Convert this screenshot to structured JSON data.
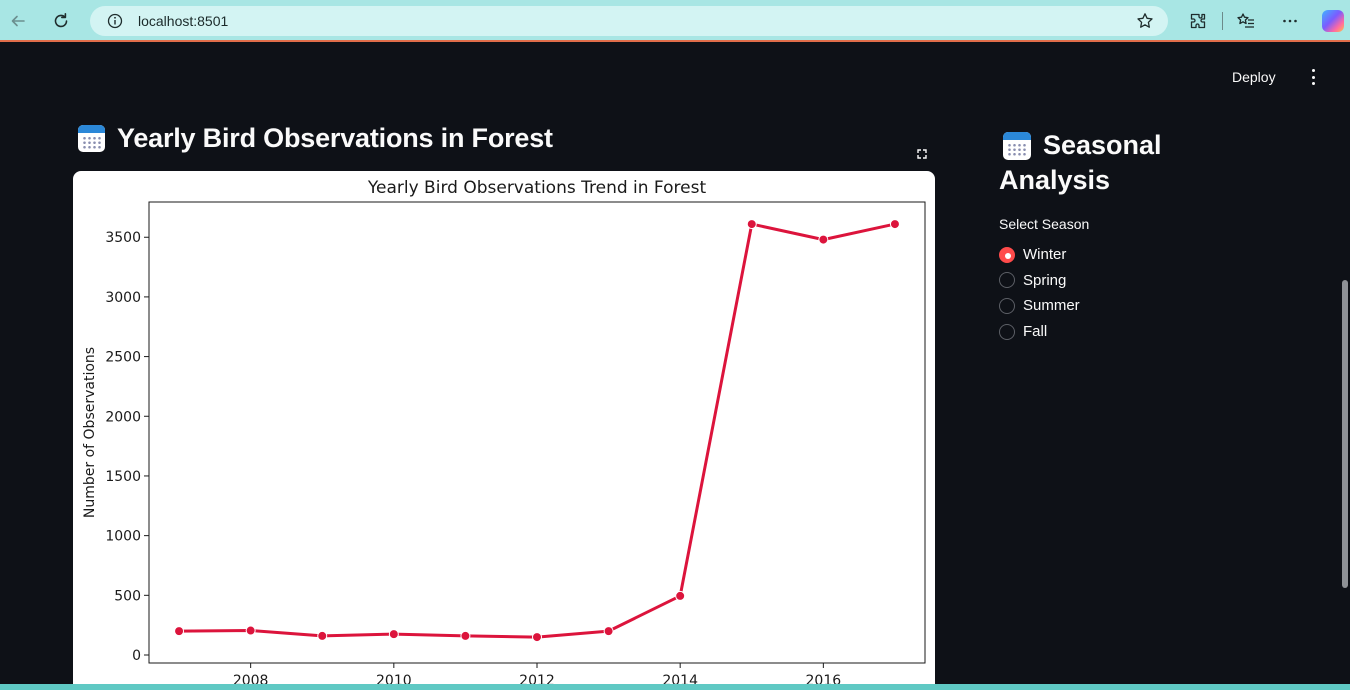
{
  "browser": {
    "url": "localhost:8501"
  },
  "header": {
    "deploy_label": "Deploy"
  },
  "main": {
    "title": "Yearly Bird Observations in Forest",
    "title_icon": "calendar-icon"
  },
  "sidebar": {
    "title_line1": "Seasonal",
    "title_line2": "Analysis",
    "title_icon": "calendar-icon",
    "radio_label": "Select Season",
    "options": [
      {
        "label": "Winter",
        "checked": true
      },
      {
        "label": "Spring",
        "checked": false
      },
      {
        "label": "Summer",
        "checked": false
      },
      {
        "label": "Fall",
        "checked": false
      }
    ]
  },
  "colors": {
    "accent": "#ff4b4b",
    "line": "#dc143c",
    "background": "#0e1117"
  },
  "chart_data": {
    "type": "line",
    "title": "Yearly Bird Observations Trend in Forest",
    "xlabel": "",
    "ylabel": "Number of Observations",
    "x": [
      2007,
      2008,
      2009,
      2010,
      2011,
      2012,
      2013,
      2014,
      2015,
      2016,
      2017
    ],
    "series": [
      {
        "values": [
          200,
          205,
          160,
          175,
          160,
          150,
          200,
          495,
          3610,
          3480,
          3610
        ]
      }
    ],
    "x_ticks": [
      2008,
      2010,
      2012,
      2014,
      2016
    ],
    "y_ticks": [
      0,
      500,
      1000,
      1500,
      2000,
      2500,
      3000,
      3500
    ],
    "xlim": [
      2006.58,
      2017.42
    ],
    "ylim": [
      -67,
      3795
    ],
    "grid": false
  }
}
